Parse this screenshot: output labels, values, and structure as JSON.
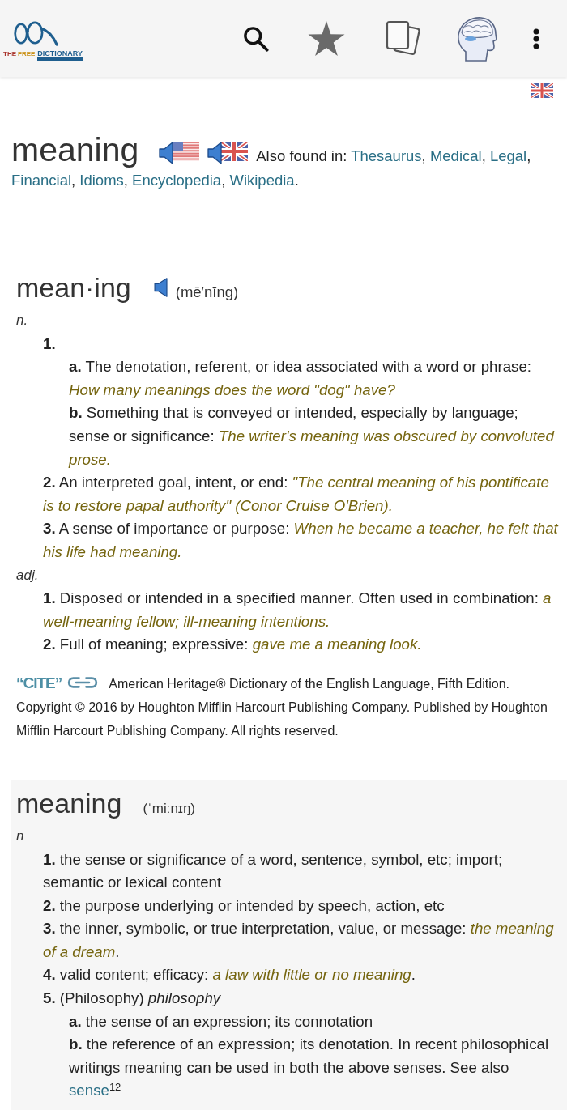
{
  "app_bar": {
    "logo": {
      "small_words": [
        "THE",
        "FREE"
      ],
      "title": "DICTIONARY"
    }
  },
  "headword": {
    "word": "meaning",
    "also_found_label": "Also found in:",
    "links": [
      {
        "label": "Thesaurus",
        "after": ","
      },
      {
        "label": "Medical",
        "after": ","
      },
      {
        "label": "Legal",
        "after": ","
      },
      {
        "label": "Financial",
        "after": ","
      },
      {
        "label": "Idioms",
        "after": ","
      },
      {
        "label": "Encyclopedia",
        "after": ","
      },
      {
        "label": "Wikipedia",
        "after": "."
      }
    ]
  },
  "entries": [
    {
      "kind": "american-heritage",
      "headword": "mean·ing",
      "pronunciation": "(mē′nĭng)",
      "pos_groups": [
        {
          "pos": "n.",
          "senses": [
            {
              "number": "1.",
              "subsenses": [
                {
                  "letter": "a.",
                  "text": "The denotation, referent, or idea associated with a word or phrase:",
                  "example": "How many meanings does the word \"dog\" have?"
                },
                {
                  "letter": "b.",
                  "text": "Something that is conveyed or intended, especially by language; sense or significance:",
                  "example": "The writer's meaning was obscured by convoluted prose."
                }
              ]
            },
            {
              "number": "2.",
              "text": "An interpreted goal, intent, or end:",
              "example": "\"The central meaning of his pontificate is to restore papal authority\" (Conor Cruise O'Brien)."
            },
            {
              "number": "3.",
              "text": "A sense of importance or purpose:",
              "example": "When he became a teacher, he felt that his life had meaning."
            }
          ]
        },
        {
          "pos": "adj.",
          "senses": [
            {
              "number": "1.",
              "text": "Disposed or intended in a specified manner. Often used in combination:",
              "example": "a well-meaning fellow; ill-meaning intentions."
            },
            {
              "number": "2.",
              "text": "Full of meaning; expressive:",
              "example": "gave me a meaning look."
            }
          ]
        }
      ],
      "citation": {
        "label": "“CITE”",
        "text": "American Heritage® Dictionary of the English Language, Fifth Edition. Copyright © 2016 by Houghton Mifflin Harcourt Publishing Company. Published by Houghton Mifflin Harcourt Publishing Company. All rights reserved."
      }
    },
    {
      "kind": "collins",
      "headword": "meaning",
      "pronunciation": "(ˈmiːnɪŋ)",
      "pos_groups": [
        {
          "pos": "n",
          "senses": [
            {
              "number": "1.",
              "text": "the sense or significance of a word, sentence, symbol, etc; import; semantic or lexical content"
            },
            {
              "number": "2.",
              "text": "the purpose underlying or intended by speech, action, etc"
            },
            {
              "number": "3.",
              "text": "the inner, symbolic, or true interpretation, value, or message:",
              "example": "the meaning of a dream",
              "after": "."
            },
            {
              "number": "4.",
              "text": "valid content; efficacy:",
              "example": "a law with little or no meaning",
              "after": "."
            },
            {
              "number": "5.",
              "text": "(Philosophy) *philosophy*",
              "subsenses": [
                {
                  "letter": "a.",
                  "text": "the sense of an expression; its connotation"
                },
                {
                  "letter": "b.",
                  "text": "the reference of an expression; its denotation. In recent philosophical writings meaning can be used in both the above senses. See also",
                  "xref": {
                    "label": "sense",
                    "sup": "12"
                  }
                }
              ]
            }
          ]
        }
      ]
    }
  ]
}
